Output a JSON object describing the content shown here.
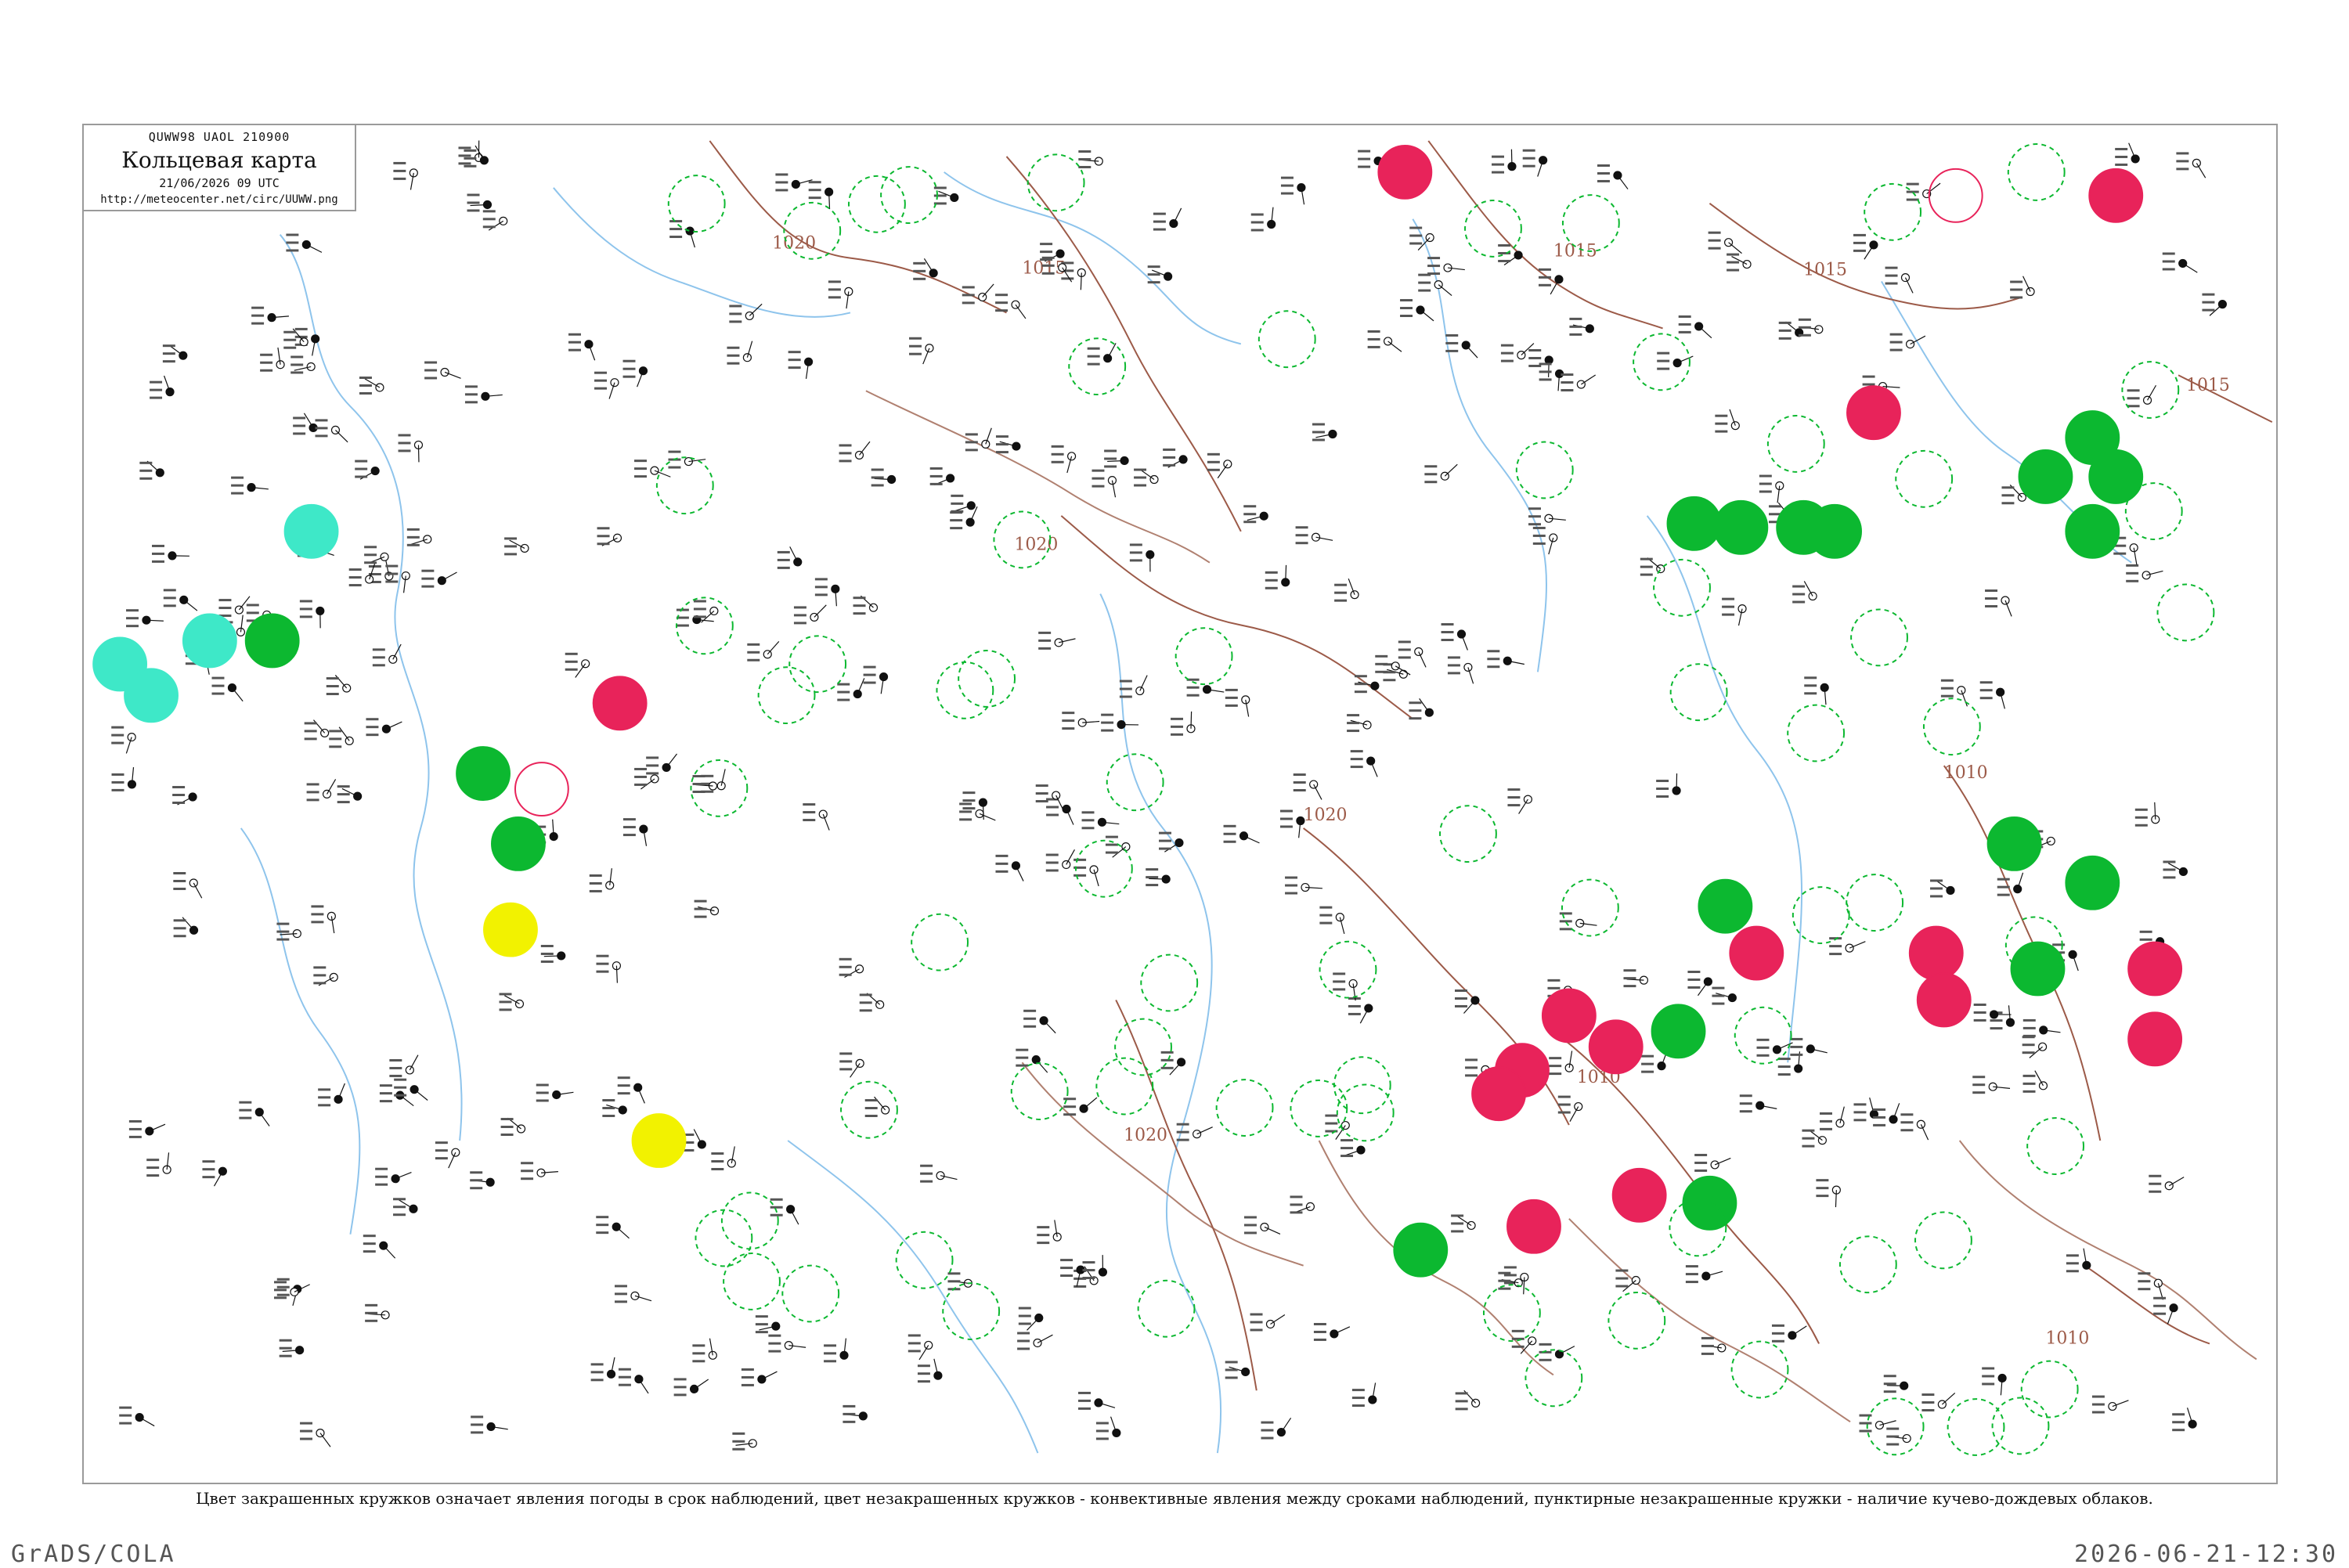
{
  "header": {
    "code": "QUWW98 UAOL 210900",
    "title": "Кольцевая карта",
    "datetime": "21/06/2026 09 UTC",
    "url": "http://meteocenter.net/circ/UUWW.png"
  },
  "isobars": [
    {
      "label": "1020"
    },
    {
      "label": "1015"
    },
    {
      "label": "1020"
    },
    {
      "label": "1015"
    },
    {
      "label": "1015"
    },
    {
      "label": "1020"
    },
    {
      "label": "1010"
    },
    {
      "label": "1020"
    },
    {
      "label": "1010"
    },
    {
      "label": "1010"
    },
    {
      "label": "1015"
    }
  ],
  "legend": {
    "caption": "Цвет закрашенных кружков означает явления погоды в срок наблюдений, цвет незакрашенных кружков - конвективные явления между сроками наблюдений, пунктирные незакрашенные кружки - наличие кучево-дождевых облаков."
  },
  "colors": {
    "red": "#e8235a",
    "green": "#0cb830",
    "cyan": "#3ee8c8",
    "yellow": "#f2f200",
    "isobar": "#9c5a48",
    "river": "#8ec4ec",
    "border": "#b08070"
  },
  "footer": {
    "left": "GrADS/COLA",
    "right": "2026-06-21-12:30"
  }
}
